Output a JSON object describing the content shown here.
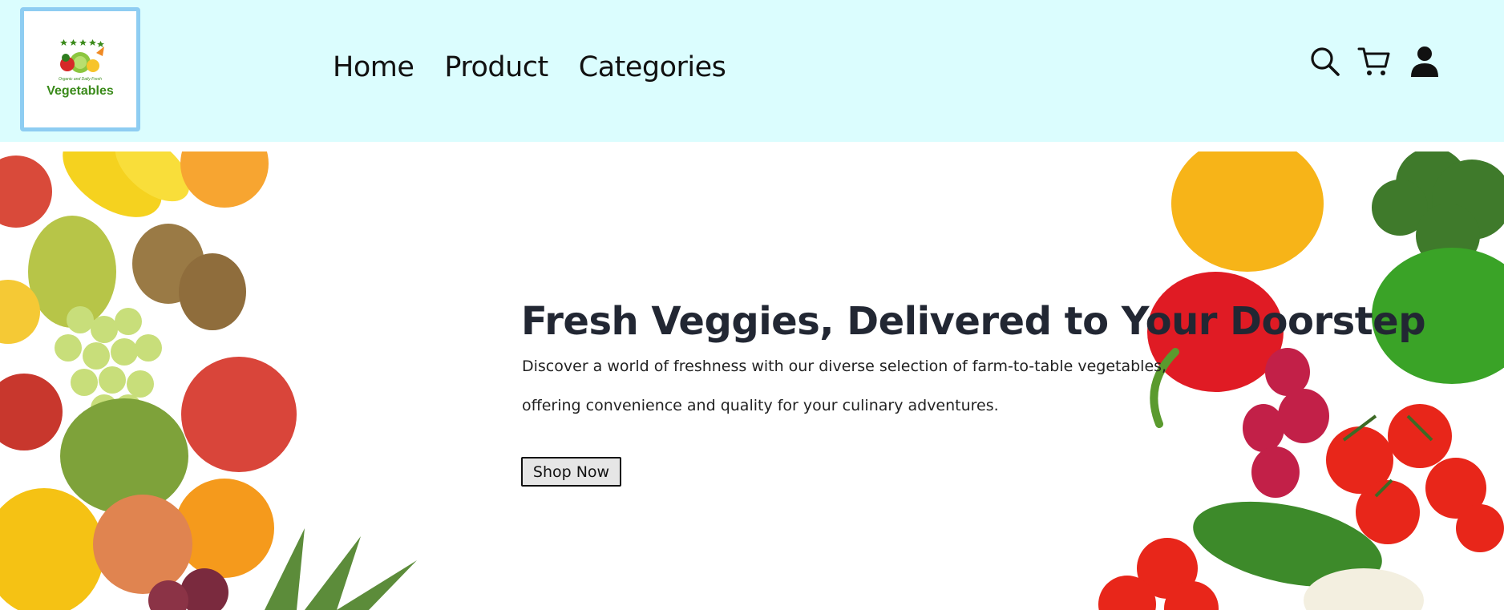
{
  "brand": {
    "name": "Vegetables",
    "tagline": "Organic and Daily Fresh"
  },
  "nav": {
    "items": [
      {
        "label": "Home"
      },
      {
        "label": "Product"
      },
      {
        "label": "Categories"
      }
    ]
  },
  "header_icons": [
    "search-icon",
    "cart-icon",
    "user-icon"
  ],
  "hero": {
    "title": "Fresh Veggies, Delivered to Your Doorstep",
    "line1": "Discover a world of freshness with our diverse selection of farm-to-table vegetables,",
    "line2": "offering convenience and quality for your culinary adventures.",
    "button_label": "Shop Now"
  },
  "colors": {
    "header_bg": "#dbfdfe",
    "logo_border": "#8ecdf2",
    "brand_green": "#3a8a1a"
  }
}
